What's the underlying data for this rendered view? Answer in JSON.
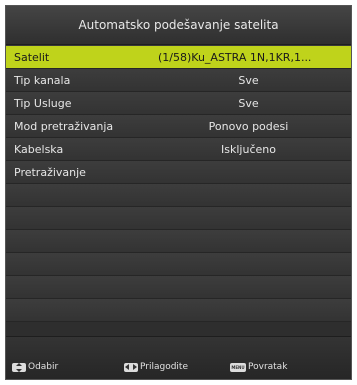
{
  "header": {
    "title": "Automatsko podešavanje satelita"
  },
  "menu": {
    "items": [
      {
        "label": "Satelit",
        "value": "(1/58)Ku_ASTRA 1N,1KR,1...",
        "selected": true
      },
      {
        "label": "Tip kanala",
        "value": "Sve"
      },
      {
        "label": "Tip Usluge",
        "value": "Sve"
      },
      {
        "label": "Mod pretraživanja",
        "value": "Ponovo podesi"
      },
      {
        "label": "Kabelska",
        "value": "Isključeno"
      },
      {
        "label": "Pretraživanje",
        "value": ""
      },
      {
        "label": "",
        "value": ""
      },
      {
        "label": "",
        "value": ""
      },
      {
        "label": "",
        "value": ""
      },
      {
        "label": "",
        "value": ""
      },
      {
        "label": "",
        "value": ""
      },
      {
        "label": "",
        "value": ""
      }
    ]
  },
  "footer": {
    "select_label": "Odabir",
    "adjust_label": "Prilagodite",
    "back_label": "Povratak",
    "menu_key_text": "MENU"
  },
  "colors": {
    "highlight": "#bfd31b",
    "panel": "#333333"
  },
  "icons": {
    "select": "updown-arrows-icon",
    "adjust": "leftright-arrows-icon",
    "back": "menu-key-icon"
  }
}
